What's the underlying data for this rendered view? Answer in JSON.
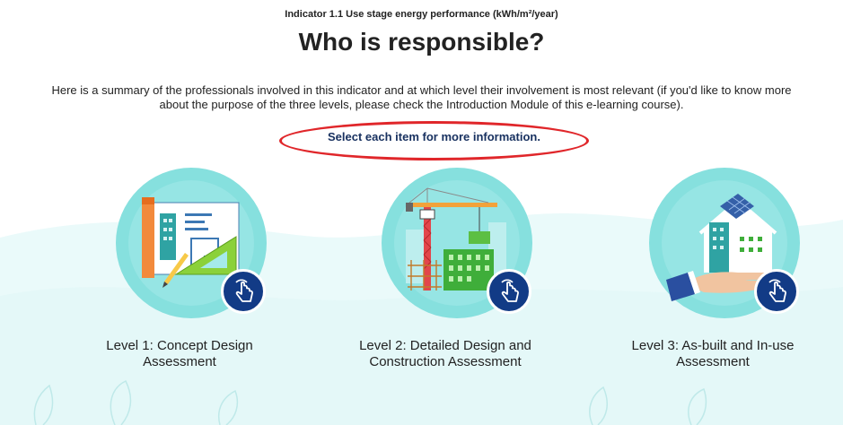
{
  "header": {
    "indicator": "Indicator 1.1 Use stage energy performance (kWh/m²/year)",
    "title": "Who is responsible?"
  },
  "intro": {
    "text": "Here is a summary of the professionals involved in this indicator and at which level their involvement is most relevant (if you'd like to know more about the purpose of the three levels, please check the Introduction Module of this e-learning course)."
  },
  "prompt": {
    "text": "Select each item for more information.",
    "highlight_color": "#e0262a"
  },
  "levels": [
    {
      "label_line1": "Level 1: Concept Design",
      "label_line2": "Assessment",
      "icon": "blueprint-ruler-icon"
    },
    {
      "label_line1": "Level 2: Detailed Design and",
      "label_line2": "Construction Assessment",
      "icon": "crane-construction-icon"
    },
    {
      "label_line1": "Level 3: As-built and In-use",
      "label_line2": "Assessment",
      "icon": "house-in-hand-icon"
    }
  ],
  "colors": {
    "circle": "#7fdcdc",
    "button": "#123b86",
    "wave": "#e8f8f8"
  }
}
